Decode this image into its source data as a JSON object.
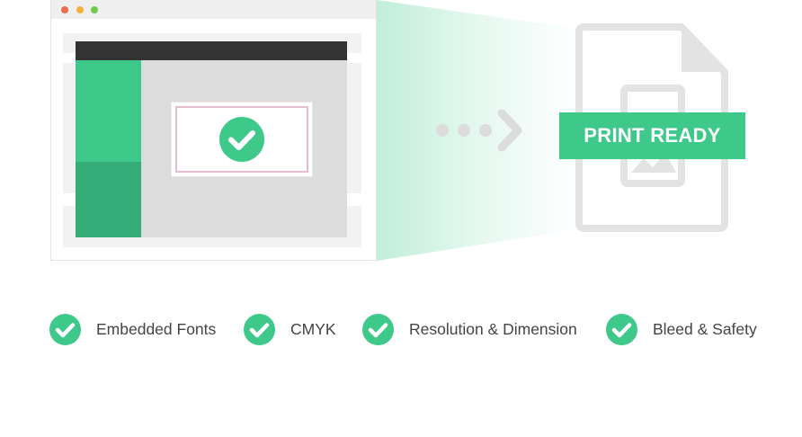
{
  "colors": {
    "accent": "#3ec98b",
    "accent_dark": "#34ad79",
    "gray_icon": "#dcdcdc",
    "window_dot_red": "#ee6a4a",
    "window_dot_yellow": "#f3b33a",
    "window_dot_green": "#6fcb4d"
  },
  "badge": {
    "label": "PRINT READY"
  },
  "features": [
    {
      "label": "Embedded Fonts",
      "icon": "check-circle-icon"
    },
    {
      "label": "CMYK",
      "icon": "check-circle-icon"
    },
    {
      "label": "Resolution & Dimension",
      "icon": "check-circle-icon"
    },
    {
      "label": "Bleed & Safety",
      "icon": "check-circle-icon"
    }
  ]
}
